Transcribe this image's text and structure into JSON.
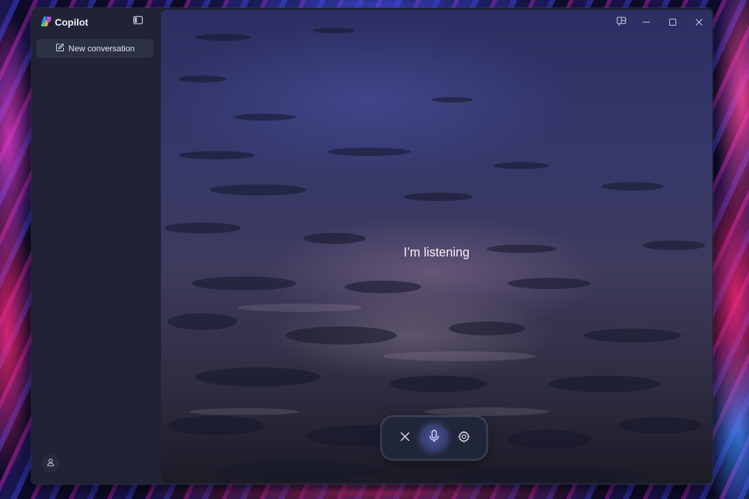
{
  "app": {
    "name": "Copilot",
    "brand_icon": "copilot-logo-icon"
  },
  "sidebar": {
    "toggle_icon": "sidebar-toggle-icon",
    "new_conversation": {
      "label": "New conversation",
      "icon": "compose-icon"
    },
    "account_icon": "account-icon"
  },
  "titlebar": {
    "buttons": [
      "snap-layout-icon",
      "minimize-icon",
      "maximize-icon",
      "close-icon"
    ]
  },
  "voice": {
    "status": "I’m listening",
    "controls": [
      "close-icon",
      "microphone-icon",
      "settings-icon"
    ]
  }
}
